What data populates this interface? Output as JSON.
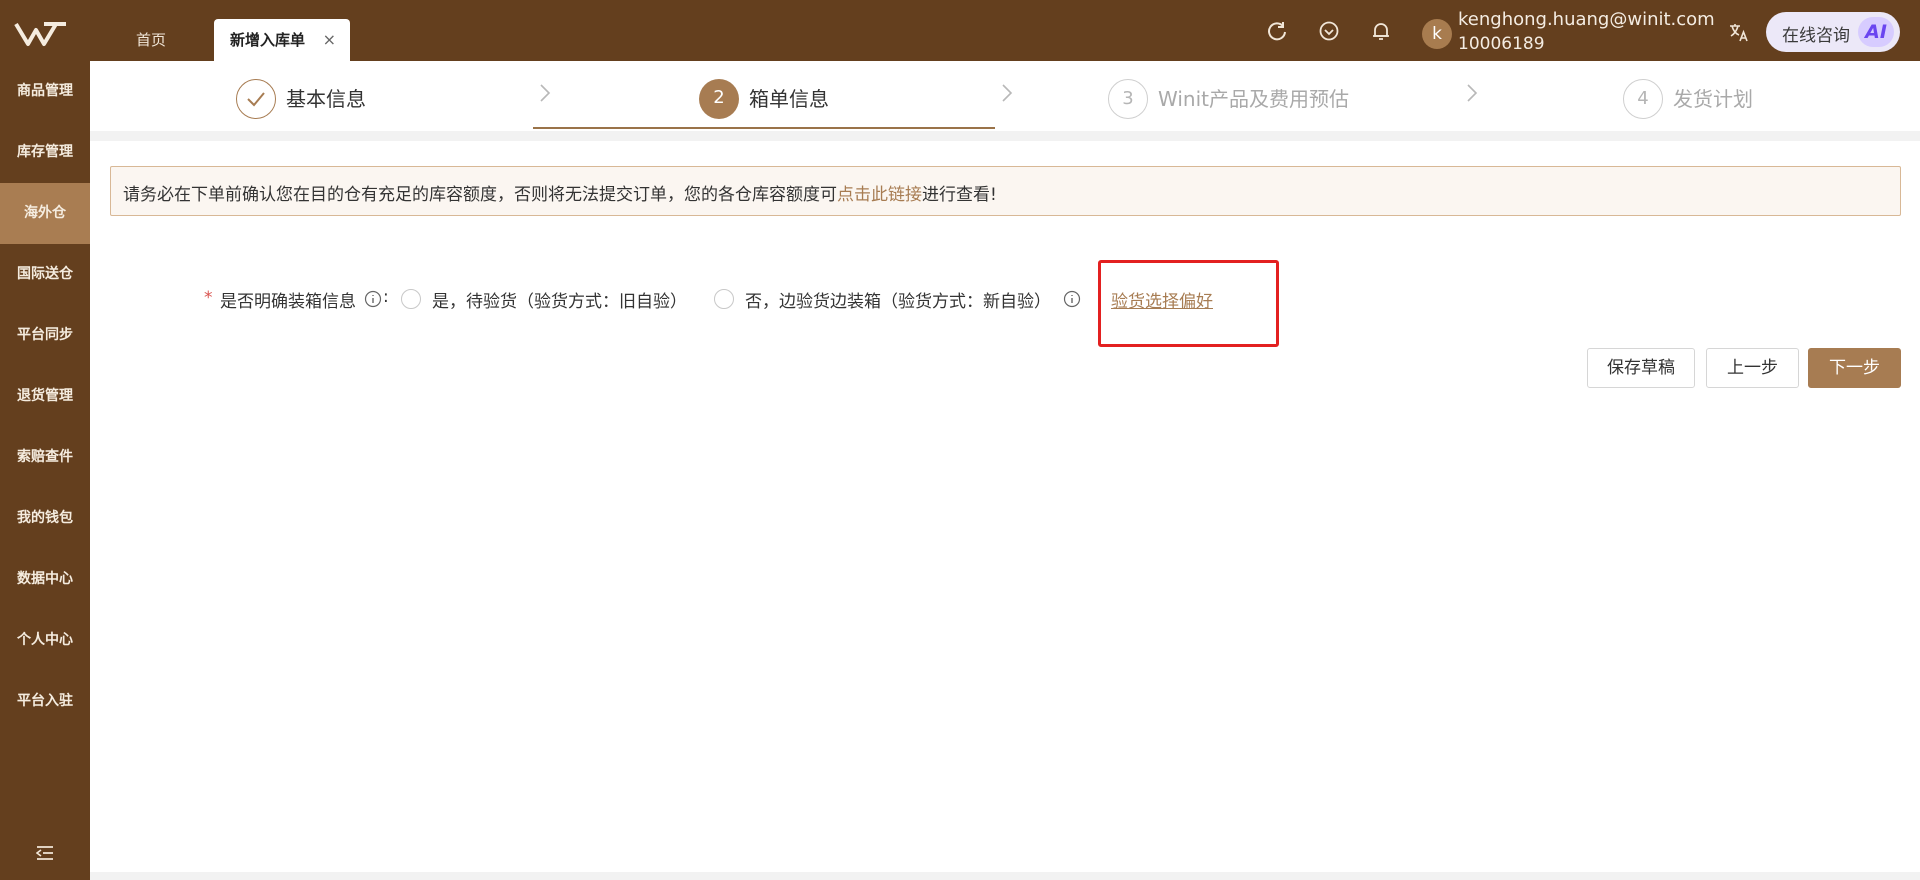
{
  "topbar": {
    "tabs": [
      {
        "label": "首页"
      },
      {
        "label": "新增入库单"
      }
    ],
    "tab_close_glyph": "×",
    "icons": [
      "refresh-icon",
      "heart-shield-icon",
      "bell-icon",
      "translate-icon"
    ],
    "user": {
      "avatar_letter": "k",
      "email": "kenghong.huang@winit.com",
      "id": "10006189"
    },
    "ai_button": {
      "label": "在线咨询",
      "badge": "AI"
    }
  },
  "sidebar": {
    "items": [
      {
        "label": "商品管理"
      },
      {
        "label": "库存管理"
      },
      {
        "label": "海外仓"
      },
      {
        "label": "国际送仓"
      },
      {
        "label": "平台同步"
      },
      {
        "label": "退货管理"
      },
      {
        "label": "索赔查件"
      },
      {
        "label": "我的钱包"
      },
      {
        "label": "数据中心"
      },
      {
        "label": "个人中心"
      },
      {
        "label": "平台入驻"
      }
    ],
    "active_item": "海外仓"
  },
  "steps": [
    {
      "number": "✓",
      "label": "基本信息",
      "state": "done"
    },
    {
      "number": "2",
      "label": "箱单信息",
      "state": "active"
    },
    {
      "number": "3",
      "label": "Winit产品及费用预估",
      "state": "pending"
    },
    {
      "number": "4",
      "label": "发货计划",
      "state": "pending"
    }
  ],
  "notice": {
    "text_before": "请务必在下单前确认您在目的仓有充足的库容额度，否则将无法提交订单，您的各仓库容额度可",
    "link": "点击此链接",
    "text_after": "进行查看!"
  },
  "form": {
    "required_mark": "*",
    "label": "是否明确装箱信息",
    "colon": ":",
    "options": [
      {
        "label": "是，待验货（验货方式：旧自验）",
        "checked": false
      },
      {
        "label": "否，边验货边装箱（验货方式：新自验）",
        "checked": false
      }
    ],
    "preference_link": "验货选择偏好"
  },
  "actions": {
    "save_draft": "保存草稿",
    "previous": "上一步",
    "next": "下一步"
  },
  "colors": {
    "brand_dark": "#643f1e",
    "brand_accent": "#a77c52",
    "highlight": "#e32020"
  }
}
